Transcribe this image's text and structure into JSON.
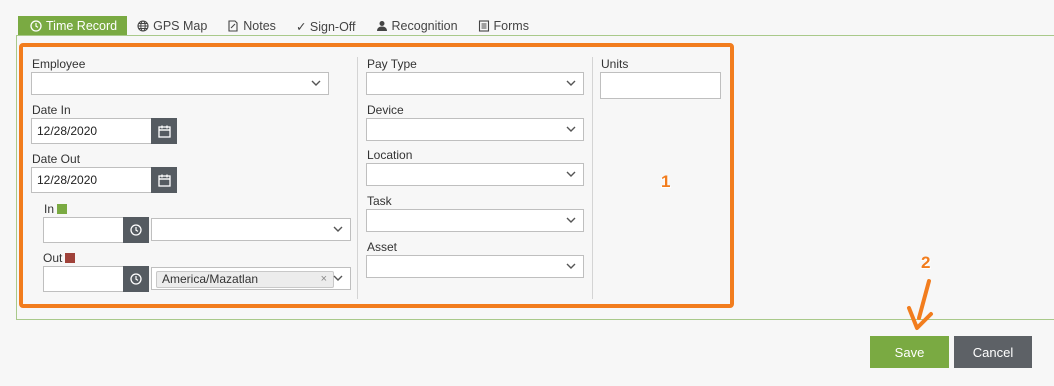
{
  "tabs": [
    {
      "label": "Time Record",
      "icon": "clock-icon",
      "active": true
    },
    {
      "label": "GPS Map",
      "icon": "globe-icon"
    },
    {
      "label": "Notes",
      "icon": "note-icon"
    },
    {
      "label": "✓ Sign-Off",
      "icon": "check-icon"
    },
    {
      "label": "Recognition",
      "icon": "person-icon"
    },
    {
      "label": "Forms",
      "icon": "form-icon"
    }
  ],
  "form": {
    "employee": {
      "label": "Employee",
      "value": ""
    },
    "date_in": {
      "label": "Date In",
      "value": "12/28/2020"
    },
    "date_out": {
      "label": "Date Out",
      "value": "12/28/2020"
    },
    "time_in": {
      "label": "In",
      "value": "",
      "timezone": "",
      "swatch_color": "#7aaa42"
    },
    "time_out": {
      "label": "Out",
      "value": "",
      "timezone": "America/Mazatlan",
      "clear_glyph": "×",
      "swatch_color": "#a0423a"
    },
    "pay_type": {
      "label": "Pay Type",
      "value": ""
    },
    "device": {
      "label": "Device",
      "value": ""
    },
    "location": {
      "label": "Location",
      "value": ""
    },
    "task": {
      "label": "Task",
      "value": ""
    },
    "asset": {
      "label": "Asset",
      "value": ""
    },
    "units": {
      "label": "Units",
      "value": ""
    }
  },
  "annotations": {
    "marker_1": "1",
    "marker_2": "2",
    "color": "#f27d1e"
  },
  "actions": {
    "save": "Save",
    "cancel": "Cancel"
  },
  "colors": {
    "accent": "#7aaa42",
    "cancel": "#5d6166",
    "addon": "#555b61"
  }
}
